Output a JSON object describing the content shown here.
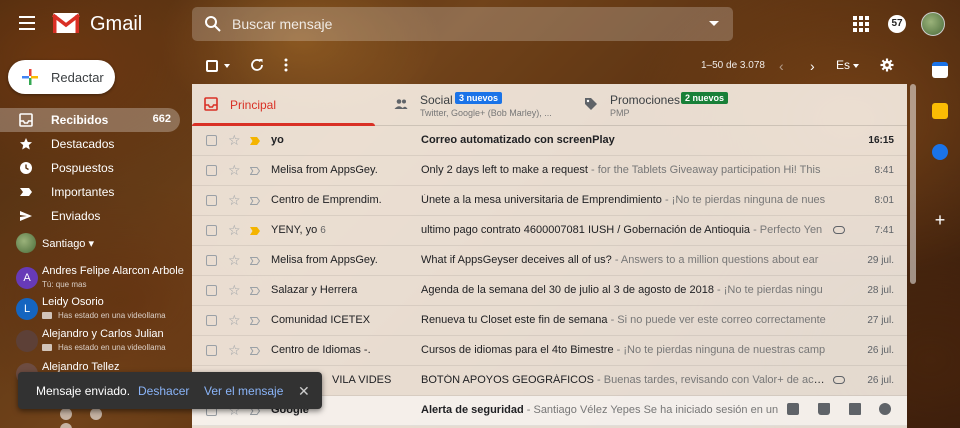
{
  "app": {
    "name": "Gmail"
  },
  "search": {
    "placeholder": "Buscar mensaje"
  },
  "header": {
    "notification_count": "57"
  },
  "compose": {
    "label": "Redactar"
  },
  "nav": {
    "items": [
      {
        "label": "Recibidos",
        "count": "662",
        "icon": "inbox-icon"
      },
      {
        "label": "Destacados",
        "count": "",
        "icon": "star-icon"
      },
      {
        "label": "Pospuestos",
        "count": "",
        "icon": "clock-icon"
      },
      {
        "label": "Importantes",
        "count": "",
        "icon": "important-icon"
      },
      {
        "label": "Enviados",
        "count": "",
        "icon": "send-icon"
      }
    ]
  },
  "hangouts": {
    "user": "Santiago",
    "contacts": [
      {
        "initial": "A",
        "name": "Andres Felipe Alarcon Arbole",
        "status": "Tú: que mas",
        "color": "#673ab7"
      },
      {
        "initial": "L",
        "name": "Leidy Osorio",
        "status": "Has estado en una videollama",
        "color": "#1565c0"
      },
      {
        "initial": "",
        "name": "Alejandro y Carlos Julian",
        "status": "Has estado en una videollama",
        "color": "#5d4037"
      },
      {
        "initial": "",
        "name": "Alejandro Tellez",
        "status": "",
        "color": "#6d4c41"
      }
    ]
  },
  "toast": {
    "message": "Mensaje enviado.",
    "undo": "Deshacer",
    "view": "Ver el mensaje"
  },
  "toolbar": {
    "range": "1–50 de 3.078",
    "lang": "Es"
  },
  "tabs": [
    {
      "label": "Principal",
      "sub": "",
      "badge": ""
    },
    {
      "label": "Social",
      "sub": "Twitter, Google+ (Bob Marley), ...",
      "badge": "3 nuevos",
      "badge_color": "#1a73e8"
    },
    {
      "label": "Promociones",
      "sub": "PMP",
      "badge": "2 nuevos",
      "badge_color": "#188038"
    }
  ],
  "emails": [
    {
      "from": "yo",
      "count": "",
      "subject": "Correo automatizado con screenPlay",
      "snippet": "",
      "date": "16:15",
      "unread": true,
      "important": true,
      "attach": false
    },
    {
      "from": "Melisa from AppsGey.",
      "count": "",
      "subject": "Only 2 days left to make a request",
      "snippet": " - for the Tablets Giveaway participation Hi! This",
      "date": "8:41",
      "unread": false,
      "important": false,
      "attach": false
    },
    {
      "from": "Centro de Emprendim.",
      "count": "",
      "subject": "Únete a la mesa universitaria de Emprendimiento",
      "snippet": " - ¡No te pierdas ninguna de nues",
      "date": "8:01",
      "unread": false,
      "important": false,
      "attach": false
    },
    {
      "from": "YENY, yo",
      "count": "6",
      "subject": "ultimo pago contrato 4600007081 IUSH / Gobernación de Antioquia",
      "snippet": " - Perfecto Yen",
      "date": "7:41",
      "unread": false,
      "important": true,
      "attach": true
    },
    {
      "from": "Melisa from AppsGey.",
      "count": "",
      "subject": "What if AppsGeyser deceives all of us?",
      "snippet": " - Answers to a million questions about ear",
      "date": "29 jul.",
      "unread": false,
      "important": false,
      "attach": false
    },
    {
      "from": "Salazar y Herrera",
      "count": "",
      "subject": "Agenda de la semana del 30 de julio al 3 de agosto de 2018",
      "snippet": " - ¡No te pierdas ningu",
      "date": "28 jul.",
      "unread": false,
      "important": false,
      "attach": false
    },
    {
      "from": "Comunidad ICETEX",
      "count": "",
      "subject": "Renueva tu Closet este fin de semana",
      "snippet": " - Si no puede ver este correo correctamente",
      "date": "27 jul.",
      "unread": false,
      "important": false,
      "attach": false
    },
    {
      "from": "Centro de Idiomas -.",
      "count": "",
      "subject": "Cursos de idiomas para el 4to Bimestre",
      "snippet": " - ¡No te pierdas ninguna de nuestras camp",
      "date": "26 jul.",
      "unread": false,
      "important": false,
      "attach": false
    },
    {
      "from": "VILA VIDES",
      "count": "",
      "subject": "BOTÓN APOYOS GEOGRÁFICOS",
      "snippet": " - Buenas tardes, revisando con Valor+ de acuerdo",
      "date": "26 jul.",
      "unread": false,
      "important": false,
      "attach": true
    },
    {
      "from": "Google",
      "count": "",
      "subject": "Alerta de seguridad",
      "snippet": " - Santiago Vélez Yepes Se ha iniciado sesión en un",
      "date": "",
      "unread": true,
      "important": false,
      "attach": false
    }
  ],
  "colors": {
    "accent": "#d93025",
    "link": "#8ab4f8"
  }
}
